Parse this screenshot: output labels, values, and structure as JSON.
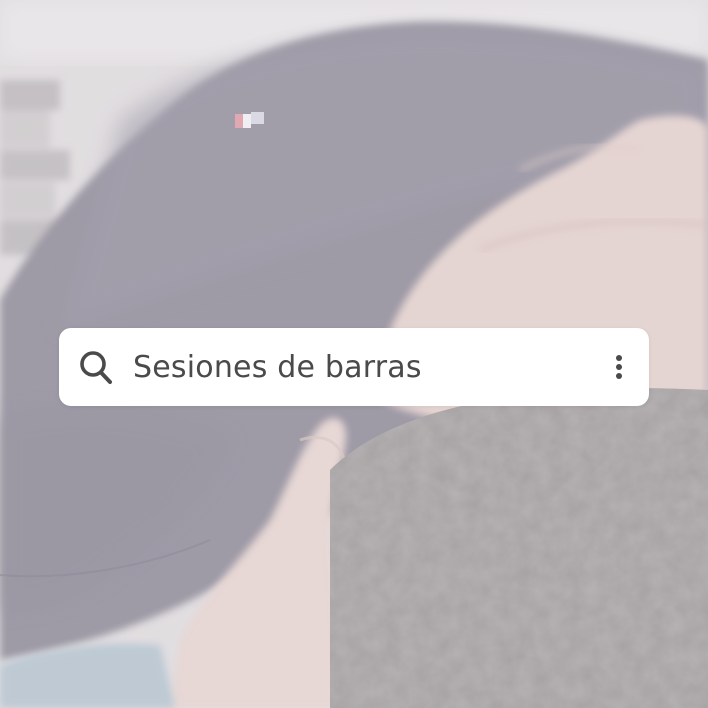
{
  "search": {
    "query": "Sesiones de barras",
    "icon": "search-icon",
    "menu_icon": "more-vertical-icon"
  },
  "background": {
    "scene": "photo"
  }
}
